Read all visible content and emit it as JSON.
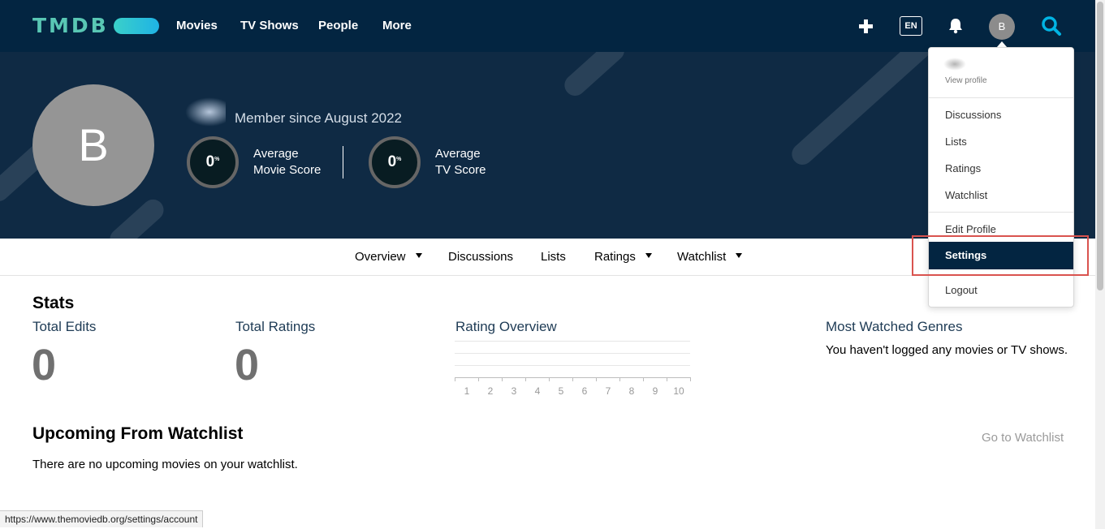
{
  "header": {
    "logo": "TMDB",
    "nav": [
      "Movies",
      "TV Shows",
      "People",
      "More"
    ],
    "language": "EN",
    "avatar_initial": "B"
  },
  "profile": {
    "avatar_initial": "B",
    "member_since": "Member since August 2022",
    "movie_score": "0",
    "movie_score_label_line1": "Average",
    "movie_score_label_line2": "Movie Score",
    "tv_score": "0",
    "tv_score_label_line1": "Average",
    "tv_score_label_line2": "TV Score",
    "percent_symbol": "%"
  },
  "subnav": {
    "overview": "Overview",
    "discussions": "Discussions",
    "lists": "Lists",
    "ratings": "Ratings",
    "watchlist": "Watchlist"
  },
  "stats": {
    "title": "Stats",
    "total_edits_label": "Total Edits",
    "total_edits_value": "0",
    "total_ratings_label": "Total Ratings",
    "total_ratings_value": "0",
    "rating_overview_title": "Rating Overview",
    "rating_ticks": [
      "1",
      "2",
      "3",
      "4",
      "5",
      "6",
      "7",
      "8",
      "9",
      "10"
    ],
    "most_watched_title": "Most Watched Genres",
    "most_watched_empty": "You haven't logged any movies or TV shows."
  },
  "upcoming": {
    "title": "Upcoming From Watchlist",
    "empty": "There are no upcoming movies on your watchlist.",
    "go_link": "Go to Watchlist"
  },
  "dropdown": {
    "view_profile": "View profile",
    "items": [
      "Discussions",
      "Lists",
      "Ratings",
      "Watchlist"
    ],
    "edit_profile": "Edit Profile",
    "settings": "Settings",
    "logout": "Logout"
  },
  "status_bar": {
    "url": "https://www.themoviedb.org/settings/account"
  },
  "colors": {
    "header_bg": "#032541",
    "hero_bg": "#0f2a44",
    "accent": "#01b4e4",
    "highlight": "#d9534f"
  }
}
